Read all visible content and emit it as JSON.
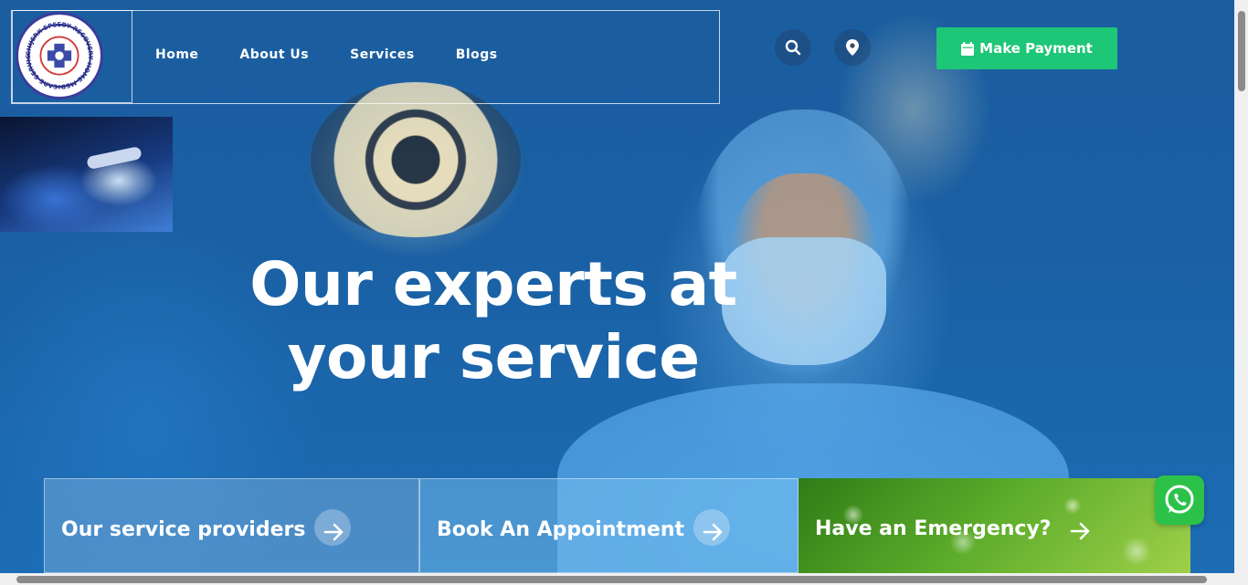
{
  "header": {
    "logo_text": "CHIJERX SPEEDY RECOVERY HOME MEDICARE SERVICES LTD",
    "nav": [
      {
        "label": "Home"
      },
      {
        "label": "About Us"
      },
      {
        "label": "Services"
      },
      {
        "label": "Blogs"
      }
    ],
    "search_icon": "search-icon",
    "location_icon": "map-pin-icon",
    "payment_button": {
      "label": "Make Payment",
      "icon": "calendar-icon"
    }
  },
  "hero": {
    "headline_line1": "Our experts at",
    "headline_line2": "your service"
  },
  "cards": [
    {
      "label": "Our service providers",
      "icon": "arrow-right-icon"
    },
    {
      "label": "Book An Appointment",
      "icon": "arrow-right-icon"
    },
    {
      "label": "Have an Emergency?",
      "icon": "arrow-right-icon"
    }
  ],
  "floating": {
    "whatsapp_icon": "whatsapp-icon"
  },
  "colors": {
    "accent_green": "#1ec677",
    "whatsapp_green": "#2cc24a",
    "hero_blue": "#1b5e9f",
    "logo_navy": "#2b2f8a"
  }
}
